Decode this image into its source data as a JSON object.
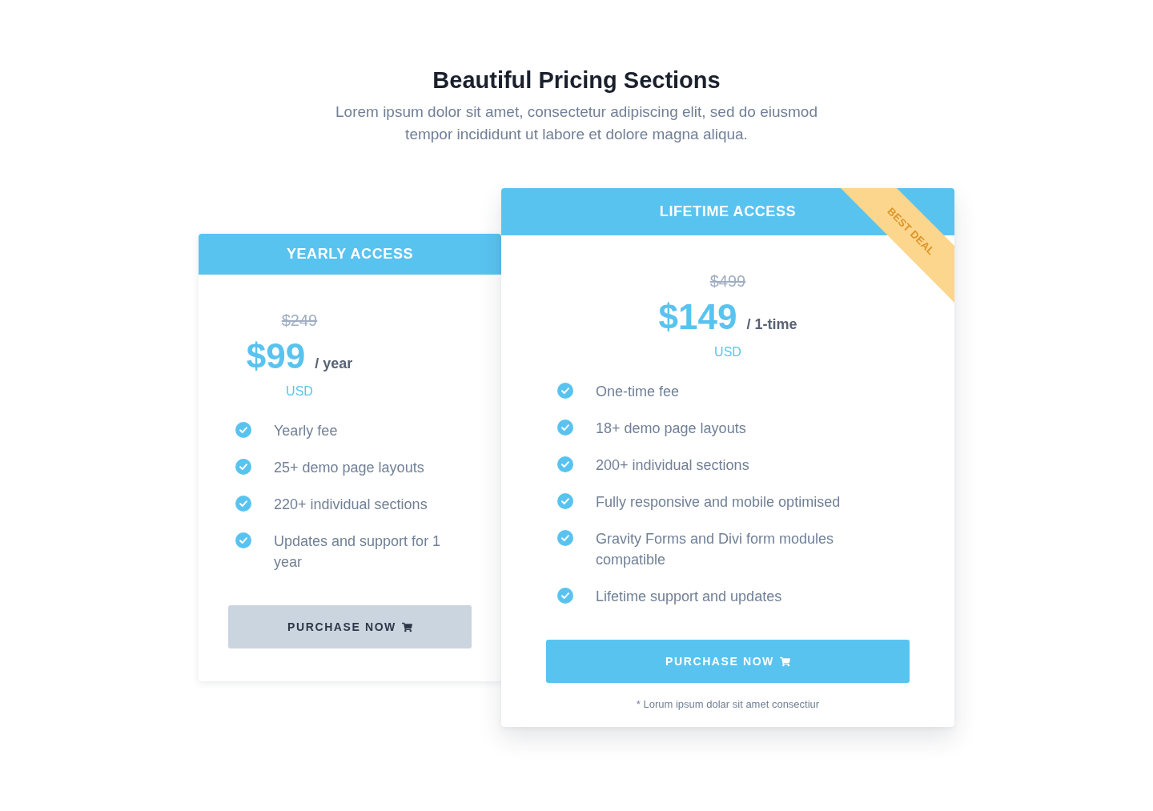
{
  "header": {
    "title": "Beautiful Pricing Sections",
    "subtitle": "Lorem ipsum dolor sit amet, consectetur adipiscing elit, sed do eiusmod tempor incididunt ut labore et dolore magna aliqua."
  },
  "plans": [
    {
      "name": "YEARLY ACCESS",
      "featured": false,
      "old_price": "$249",
      "price": "$99",
      "period": "/ year",
      "currency": "USD",
      "features": [
        "Yearly fee",
        "25+ demo page layouts",
        "220+ individual sections",
        "Updates and support for 1 year"
      ],
      "button": "PURCHASE NOW"
    },
    {
      "name": "LIFETIME ACCESS",
      "featured": true,
      "ribbon": "BEST DEAL",
      "old_price": "$499",
      "price": "$149",
      "period": "/ 1-time",
      "currency": "USD",
      "features": [
        "One-time fee",
        "18+ demo page layouts",
        "200+ individual sections",
        "Fully responsive and mobile optimised",
        "Gravity Forms and Divi form modules compatible",
        "Lifetime support and updates"
      ],
      "button": "PURCHASE NOW",
      "footnote": "* Lorum ipsum dolar sit amet consectiur"
    }
  ]
}
